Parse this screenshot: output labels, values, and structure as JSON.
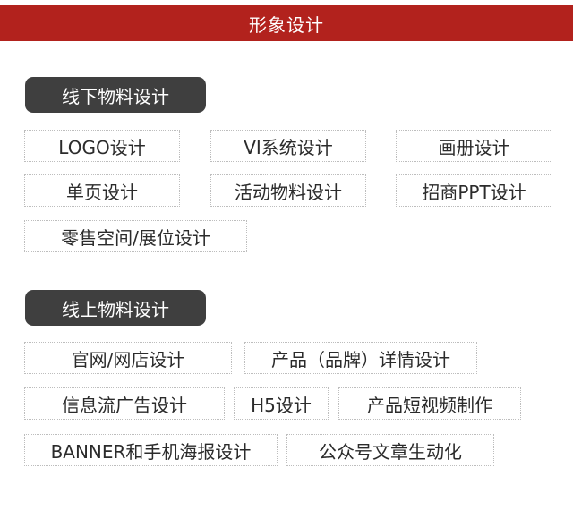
{
  "header": {
    "title": "形象设计"
  },
  "sections": [
    {
      "title": "线下物料设计",
      "items": [
        "LOGO设计",
        "VI系统设计",
        "画册设计",
        "单页设计",
        "活动物料设计",
        "招商PPT设计",
        "零售空间/展位设计"
      ]
    },
    {
      "title": "线上物料设计",
      "items": [
        "官网/网店设计",
        "产品（品牌）详情设计",
        "信息流广告设计",
        "H5设计",
        "产品短视频制作",
        "BANNER和手机海报设计",
        "公众号文章生动化"
      ]
    }
  ],
  "colors": {
    "header_bg": "#b2221d",
    "pill_bg": "#3f3f3f",
    "chip_border": "#bdbdbd"
  }
}
